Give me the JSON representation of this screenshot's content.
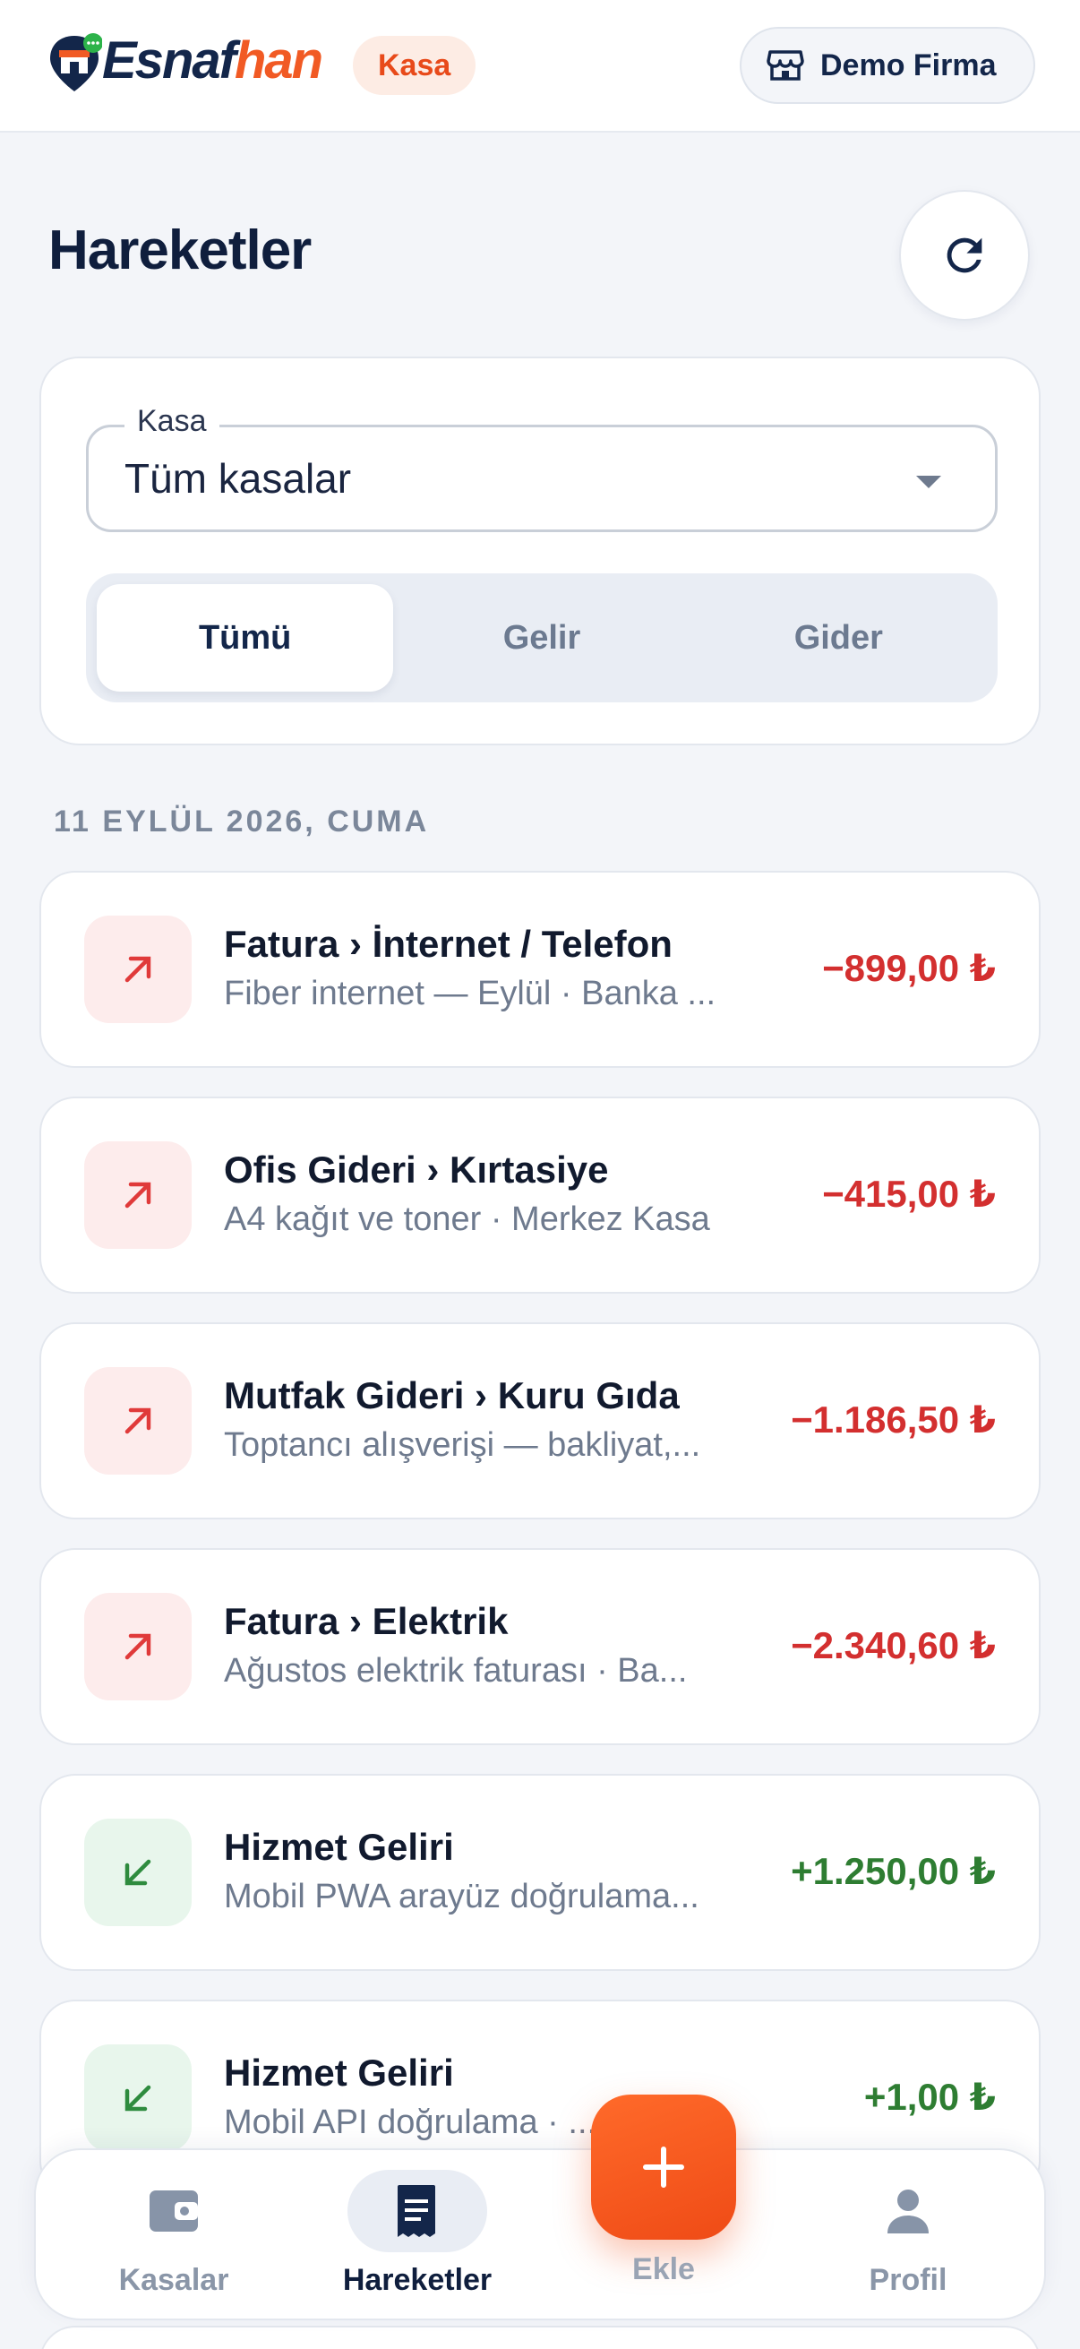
{
  "header": {
    "logo_part1": "Esnaf",
    "logo_part2": "han",
    "app_badge": "Kasa",
    "company_label": "Demo Firma"
  },
  "page": {
    "title": "Hareketler"
  },
  "filter": {
    "select_label": "Kasa",
    "select_value": "Tüm kasalar",
    "segments": [
      "Tümü",
      "Gelir",
      "Gider"
    ],
    "active_segment": "Tümü"
  },
  "date_header": "11 EYLÜL 2026, CUMA",
  "transactions": [
    {
      "type": "expense",
      "title": "Fatura › İnternet / Telefon",
      "subtitle": "Fiber internet — Eylül · Banka ...",
      "amount": "−899,00 ₺"
    },
    {
      "type": "expense",
      "title": "Ofis Gideri › Kırtasiye",
      "subtitle": "A4 kağıt ve toner · Merkez Kasa",
      "amount": "−415,00 ₺"
    },
    {
      "type": "expense",
      "title": "Mutfak Gideri › Kuru Gıda",
      "subtitle": "Toptancı alışverişi — bakliyat,...",
      "amount": "−1.186,50 ₺"
    },
    {
      "type": "expense",
      "title": "Fatura › Elektrik",
      "subtitle": "Ağustos elektrik faturası · Ba...",
      "amount": "−2.340,60 ₺"
    },
    {
      "type": "income",
      "title": "Hizmet Geliri",
      "subtitle": "Mobil PWA arayüz doğrulama...",
      "amount": "+1.250,00 ₺"
    },
    {
      "type": "income",
      "title": "Hizmet Geliri",
      "subtitle": "Mobil API doğrulama · ... —...",
      "amount": "+1,00 ₺"
    }
  ],
  "bottom_nav": {
    "items": [
      "Kasalar",
      "Hareketler",
      "Ekle",
      "Profil"
    ],
    "active": "Hareketler"
  },
  "colors": {
    "brand_orange": "#f15a24",
    "navy": "#13264a",
    "expense_red": "#d32f2f",
    "income_green": "#2e7d32"
  },
  "icons": {
    "refresh": "refresh-icon",
    "store": "store-icon",
    "expense": "arrow-up-right-icon",
    "income": "arrow-down-left-icon",
    "kasalar": "wallet-icon",
    "hareketler": "receipt-icon",
    "ekle": "plus-icon",
    "profil": "person-icon"
  }
}
